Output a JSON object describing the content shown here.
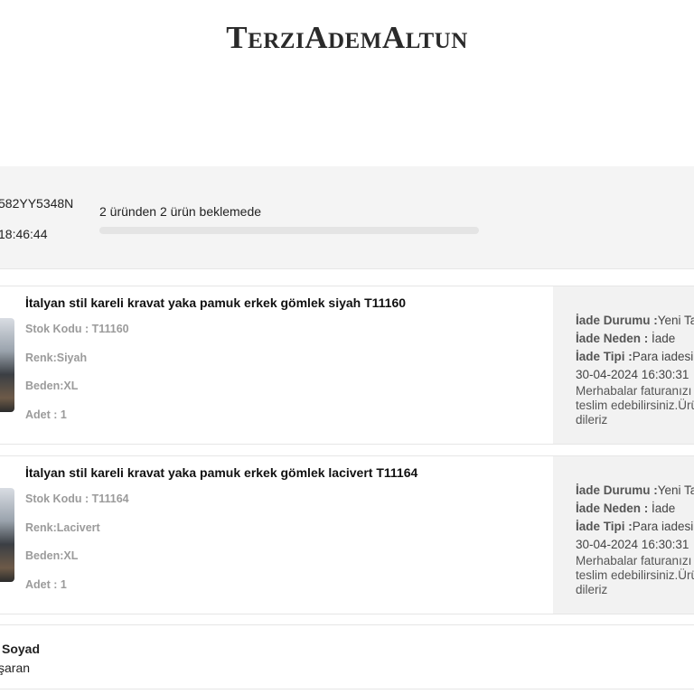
{
  "brand": {
    "logo_text": "TerziAdemAltun"
  },
  "order": {
    "order_no": "582YY5348N",
    "order_time": "18:46:44",
    "progress_text": "2 üründen 2 ürün beklemede",
    "progress_fraction": 0.0
  },
  "items": [
    {
      "title": "İtalyan stil kareli kravat yaka pamuk erkek gömlek siyah T11160",
      "stock_code": "Stok Kodu : T11160",
      "color": "Renk:Siyah",
      "size": "Beden:XL",
      "quantity": "Adet : 1",
      "return": {
        "status_label": "İade Durumu :",
        "status_value": "Yeni Ta",
        "reason_label": "İade Neden :",
        "reason_value": " İade",
        "type_label": "İade Tipi :",
        "type_value": "Para iadesi",
        "date": "30-04-2024 16:30:31",
        "message_line1": "Merhabalar faturanızı",
        "message_line2": "teslim edebilirsiniz.Ürü",
        "message_line3": "dileriz"
      }
    },
    {
      "title": "İtalyan stil kareli kravat yaka pamuk erkek gömlek lacivert T11164",
      "stock_code": "Stok Kodu : T11164",
      "color": "Renk:Lacivert",
      "size": "Beden:XL",
      "quantity": "Adet : 1",
      "return": {
        "status_label": "İade Durumu :",
        "status_value": "Yeni Ta",
        "reason_label": "İade Neden :",
        "reason_value": " İade",
        "type_label": "İade Tipi :",
        "type_value": "Para iadesi",
        "date": "30-04-2024 16:30:31",
        "message_line1": "Merhabalar faturanızı",
        "message_line2": "teslim edebilirsiniz.Ürü",
        "message_line3": "dileriz"
      }
    }
  ],
  "footer": {
    "name": "Soyad",
    "sub": "şaran"
  }
}
